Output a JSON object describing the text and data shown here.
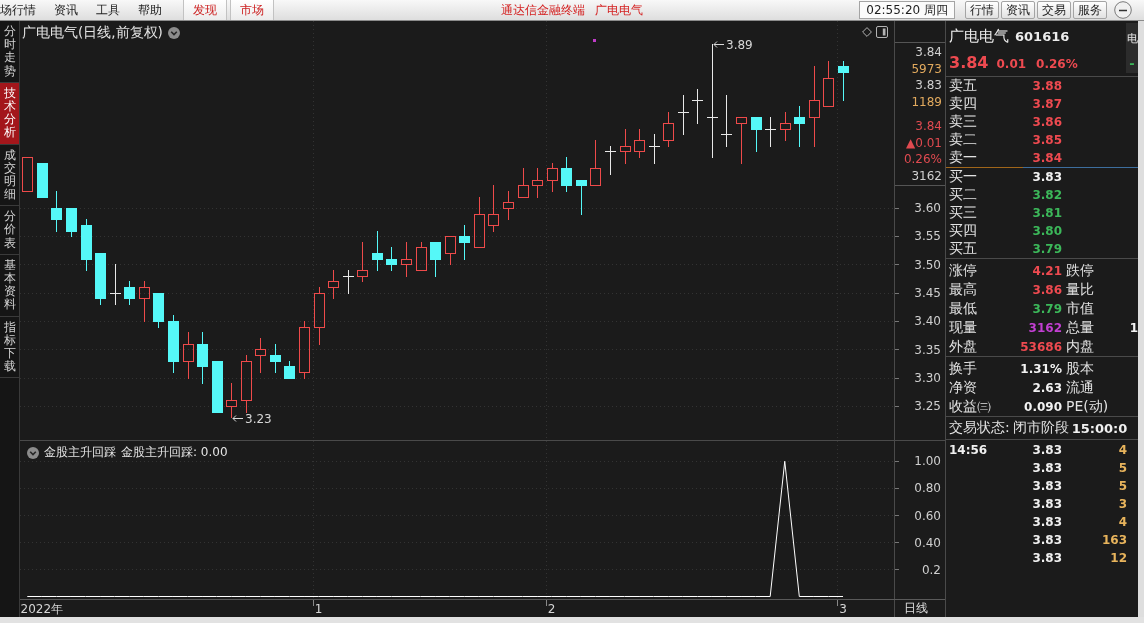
{
  "menu_bar": {
    "menus": [
      "场行情",
      "资讯",
      "工具",
      "帮助"
    ],
    "tabs": [
      "发现",
      "市场"
    ],
    "app_title": "通达信金融终端",
    "stock_title": "广电电气",
    "clock": "02:55:20 周四",
    "buttons": [
      "行情",
      "资讯",
      "交易",
      "服务"
    ]
  },
  "side_tabs": [
    {
      "label": "分时走势",
      "selected": false
    },
    {
      "label": "技术分析",
      "selected": true
    },
    {
      "label": "成交明细",
      "selected": false
    },
    {
      "label": "分价表",
      "selected": false
    },
    {
      "label": "基本资料",
      "selected": false
    },
    {
      "label": "指标下载",
      "selected": false
    }
  ],
  "price_chart": {
    "title": "广电电气(日线,前复权)",
    "chart_data": [
      {
        "type": "candlestick",
        "grid": true,
        "categories": [
          null,
          null,
          null,
          null,
          null,
          null,
          null,
          null,
          null,
          null,
          null,
          null,
          null,
          null,
          null,
          null,
          null,
          null,
          null,
          null,
          null,
          null,
          null,
          null,
          null,
          null,
          null,
          null,
          null,
          null,
          null,
          null,
          null,
          null,
          null,
          null,
          null,
          null,
          null,
          null,
          null,
          null,
          null,
          null,
          null,
          null,
          null,
          null,
          null,
          null,
          null,
          null,
          null,
          null,
          null,
          null,
          null,
          null,
          null,
          null
        ],
        "ylim": [
          3.19,
          3.93
        ],
        "yticks": [
          {
            "value": 3.6,
            "label": "3.60"
          },
          {
            "value": 3.55,
            "label": "3.55"
          },
          {
            "value": 3.5,
            "label": "3.50"
          },
          {
            "value": 3.45,
            "label": "3.45"
          },
          {
            "value": 3.4,
            "label": "3.40"
          },
          {
            "value": 3.35,
            "label": "3.35"
          },
          {
            "value": 3.3,
            "label": "3.30"
          },
          {
            "value": 3.25,
            "label": "3.25"
          }
        ],
        "ohlc": [
          [
            3.63,
            3.69,
            3.63,
            3.69
          ],
          [
            3.68,
            3.68,
            3.62,
            3.62
          ],
          [
            3.6,
            3.63,
            3.56,
            3.58
          ],
          [
            3.6,
            3.6,
            3.55,
            3.56
          ],
          [
            3.57,
            3.58,
            3.49,
            3.51
          ],
          [
            3.52,
            3.52,
            3.43,
            3.44
          ],
          [
            3.45,
            3.5,
            3.43,
            3.45
          ],
          [
            3.46,
            3.47,
            3.43,
            3.44
          ],
          [
            3.44,
            3.47,
            3.4,
            3.46
          ],
          [
            3.45,
            3.45,
            3.39,
            3.4
          ],
          [
            3.4,
            3.41,
            3.31,
            3.33
          ],
          [
            3.33,
            3.38,
            3.3,
            3.36
          ],
          [
            3.36,
            3.38,
            3.29,
            3.32
          ],
          [
            3.33,
            3.33,
            3.24,
            3.24
          ],
          [
            3.25,
            3.29,
            3.23,
            3.26
          ],
          [
            3.26,
            3.34,
            3.24,
            3.33
          ],
          [
            3.34,
            3.37,
            3.31,
            3.35
          ],
          [
            3.34,
            3.36,
            3.31,
            3.33
          ],
          [
            3.32,
            3.33,
            3.3,
            3.3
          ],
          [
            3.31,
            3.4,
            3.3,
            3.39
          ],
          [
            3.39,
            3.46,
            3.36,
            3.45
          ],
          [
            3.46,
            3.49,
            3.44,
            3.47
          ],
          [
            3.48,
            3.49,
            3.45,
            3.48
          ],
          [
            3.48,
            3.54,
            3.47,
            3.49
          ],
          [
            3.52,
            3.56,
            3.49,
            3.51
          ],
          [
            3.51,
            3.53,
            3.49,
            3.5
          ],
          [
            3.5,
            3.54,
            3.48,
            3.51
          ],
          [
            3.49,
            3.54,
            3.49,
            3.53
          ],
          [
            3.54,
            3.54,
            3.48,
            3.51
          ],
          [
            3.52,
            3.55,
            3.5,
            3.55
          ],
          [
            3.55,
            3.57,
            3.51,
            3.54
          ],
          [
            3.53,
            3.62,
            3.53,
            3.59
          ],
          [
            3.57,
            3.64,
            3.56,
            3.59
          ],
          [
            3.6,
            3.63,
            3.58,
            3.61
          ],
          [
            3.62,
            3.67,
            3.62,
            3.64
          ],
          [
            3.64,
            3.67,
            3.62,
            3.65
          ],
          [
            3.65,
            3.68,
            3.63,
            3.67
          ],
          [
            3.67,
            3.69,
            3.63,
            3.64
          ],
          [
            3.65,
            3.65,
            3.59,
            3.64
          ],
          [
            3.64,
            3.72,
            3.64,
            3.67
          ],
          [
            3.7,
            3.71,
            3.66,
            3.7
          ],
          [
            3.7,
            3.74,
            3.68,
            3.71
          ],
          [
            3.7,
            3.74,
            3.69,
            3.72
          ],
          [
            3.71,
            3.73,
            3.68,
            3.71
          ],
          [
            3.72,
            3.77,
            3.71,
            3.75
          ],
          [
            3.77,
            3.8,
            3.73,
            3.77
          ],
          [
            3.79,
            3.81,
            3.75,
            3.79
          ],
          [
            3.76,
            3.89,
            3.69,
            3.76
          ],
          [
            3.73,
            3.8,
            3.71,
            3.73
          ],
          [
            3.75,
            3.76,
            3.68,
            3.76
          ],
          [
            3.76,
            3.76,
            3.7,
            3.74
          ],
          [
            3.74,
            3.76,
            3.71,
            3.74
          ],
          [
            3.74,
            3.77,
            3.72,
            3.75
          ],
          [
            3.76,
            3.78,
            3.71,
            3.75
          ],
          [
            3.76,
            3.85,
            3.71,
            3.79
          ],
          [
            3.78,
            3.86,
            3.78,
            3.83
          ],
          [
            3.85,
            3.86,
            3.79,
            3.84
          ],
          null,
          null,
          null
        ],
        "annotations": [
          "3.89",
          "3.23"
        ]
      }
    ],
    "book_readouts": [
      {
        "text": "3.84",
        "color": "#d0d0d0"
      },
      {
        "text": "5973",
        "color": "#e2aa5e"
      },
      {
        "text": "3.83",
        "color": "#d0d0d0"
      },
      {
        "text": "1189",
        "color": "#e2aa5e"
      }
    ],
    "trade_readouts": [
      {
        "text": "3.84",
        "color": "#e04a50"
      },
      {
        "text": "▲0.01",
        "color": "#e04a50"
      },
      {
        "text": "0.26%",
        "color": "#e04a50"
      },
      {
        "text": "3162",
        "color": "#d0d0d0"
      }
    ]
  },
  "indicator": {
    "name": "金股主升回踩",
    "readout": "金股主升回踩: 0.00",
    "period": "日线",
    "chart_data": [
      {
        "type": "line",
        "grid": true,
        "categories": [
          null,
          "2022年",
          null,
          null,
          null,
          null,
          null,
          null,
          null,
          null,
          null,
          null,
          null,
          null,
          null,
          null,
          null,
          null,
          null,
          null,
          "1",
          null,
          null,
          null,
          null,
          null,
          null,
          null,
          null,
          null,
          null,
          null,
          null,
          null,
          null,
          null,
          "2",
          null,
          null,
          null,
          null,
          null,
          null,
          null,
          null,
          null,
          null,
          null,
          null,
          null,
          null,
          null,
          null,
          null,
          null,
          null,
          "3",
          null,
          null,
          null
        ],
        "values": [
          0,
          0,
          0,
          0,
          0,
          0,
          0,
          0,
          0,
          0,
          0,
          0,
          0,
          0,
          0,
          0,
          0,
          0,
          0,
          0,
          0,
          0,
          0,
          0,
          0,
          0,
          0,
          0,
          0,
          0,
          0,
          0,
          0,
          0,
          0,
          0,
          0,
          0,
          0,
          0,
          0,
          0,
          0,
          0,
          0,
          0,
          0,
          0,
          0,
          0,
          0,
          0,
          1,
          0,
          0,
          0,
          0,
          null,
          null,
          null
        ],
        "color": "#ffffff",
        "ylim": [
          -0.0185,
          1.15
        ],
        "yticks": [
          {
            "value": 1,
            "label": "1.00"
          },
          {
            "value": 0.8,
            "label": "0.80"
          },
          {
            "value": 0.6,
            "label": "0.60"
          },
          {
            "value": 0.4,
            "label": "0.40"
          },
          {
            "value": 0.2,
            "label": "0.2"
          }
        ]
      }
    ]
  },
  "quote": {
    "name": "广电电气",
    "code": "601616",
    "price": "3.84",
    "change": "0.01",
    "change_pct": "0.26%",
    "color": "#ee4a50"
  },
  "side_strip": {
    "label": "电",
    "value": "-"
  },
  "asks": [
    {
      "label": "卖五",
      "price": "3.88",
      "color": "#ee4a50"
    },
    {
      "label": "卖四",
      "price": "3.87",
      "color": "#ee4a50"
    },
    {
      "label": "卖三",
      "price": "3.86",
      "color": "#ee4a50"
    },
    {
      "label": "卖二",
      "price": "3.85",
      "color": "#ee4a50"
    },
    {
      "label": "卖一",
      "price": "3.84",
      "color": "#ee4a50"
    }
  ],
  "bids": [
    {
      "label": "买一",
      "price": "3.83",
      "color": "#f2f2f2"
    },
    {
      "label": "买二",
      "price": "3.82",
      "color": "#3cb85a"
    },
    {
      "label": "买三",
      "price": "3.81",
      "color": "#3cb85a"
    },
    {
      "label": "买四",
      "price": "3.80",
      "color": "#3cb85a"
    },
    {
      "label": "买五",
      "price": "3.79",
      "color": "#3cb85a"
    }
  ],
  "stats": [
    {
      "label": "涨停",
      "value": "4.21",
      "color": "#ee4a50",
      "label_2": "跌停"
    },
    {
      "label": "最高",
      "value": "3.86",
      "color": "#ee4a50",
      "label_2": "量比"
    },
    {
      "label": "最低",
      "value": "3.79",
      "color": "#3cb85a",
      "label_2": "市值"
    },
    {
      "label": "现量",
      "value": "3162",
      "color": "#c23fd2",
      "label_2": "总量",
      "value_2": "1"
    },
    {
      "label": "外盘",
      "value": "53686",
      "color": "#ee4a50",
      "label_2": "内盘"
    }
  ],
  "fundamentals": [
    {
      "label": "换手",
      "value": "1.31%",
      "label_2": "股本"
    },
    {
      "label": "净资",
      "value": "2.63",
      "label_2": "流通"
    },
    {
      "label": "收益㈢",
      "value": "0.090",
      "label_2": "PE(动)"
    }
  ],
  "status": {
    "label": "交易状态:",
    "value": "闭市阶段",
    "time": "15:00:0"
  },
  "trades": [
    {
      "time": "14:56",
      "price": "3.83",
      "volume": "4"
    },
    {
      "price": "3.83",
      "volume": "5"
    },
    {
      "price": "3.83",
      "volume": "5"
    },
    {
      "price": "3.83",
      "volume": "3"
    },
    {
      "price": "3.83",
      "volume": "4"
    },
    {
      "price": "3.83",
      "volume": "163"
    },
    {
      "price": "3.83",
      "volume": "12"
    }
  ]
}
